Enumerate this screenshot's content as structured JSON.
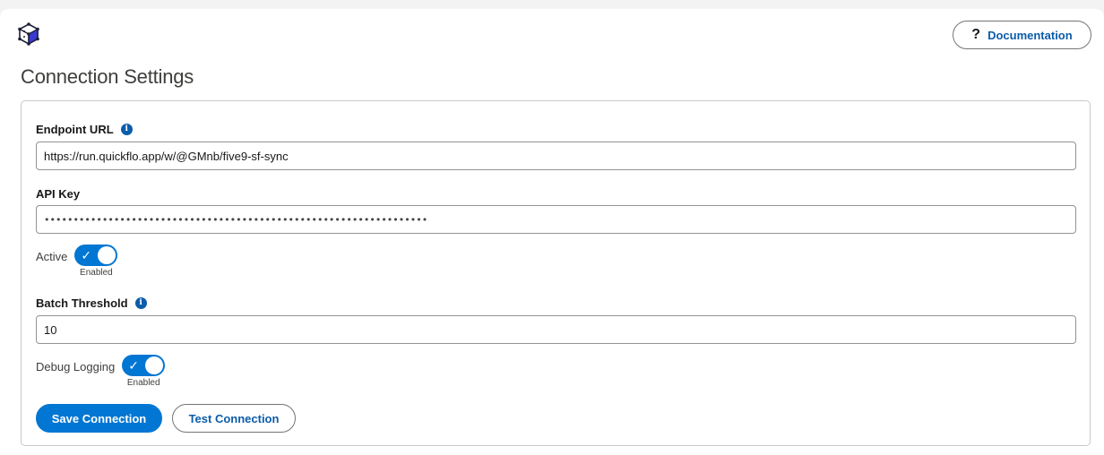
{
  "header": {
    "logo_icon": "cube-logo-icon",
    "documentation_label": "Documentation",
    "documentation_icon": "question-icon"
  },
  "page_title": "Connection Settings",
  "form": {
    "endpoint": {
      "label": "Endpoint URL",
      "value": "https://run.quickflo.app/w/@GMnb/five9-sf-sync"
    },
    "api_key": {
      "label": "API Key",
      "masked_value": "••••••••••••••••••••••••••••••••••••••••••••••••••••••••••••••••••"
    },
    "active": {
      "label": "Active",
      "state_label": "Enabled",
      "checked": true
    },
    "batch_threshold": {
      "label": "Batch Threshold",
      "value": "10"
    },
    "debug_logging": {
      "label": "Debug Logging",
      "state_label": "Enabled",
      "checked": true
    }
  },
  "actions": {
    "save_label": "Save Connection",
    "test_label": "Test Connection"
  },
  "colors": {
    "brand_blue": "#0176d3",
    "link_blue": "#0b5cab"
  }
}
